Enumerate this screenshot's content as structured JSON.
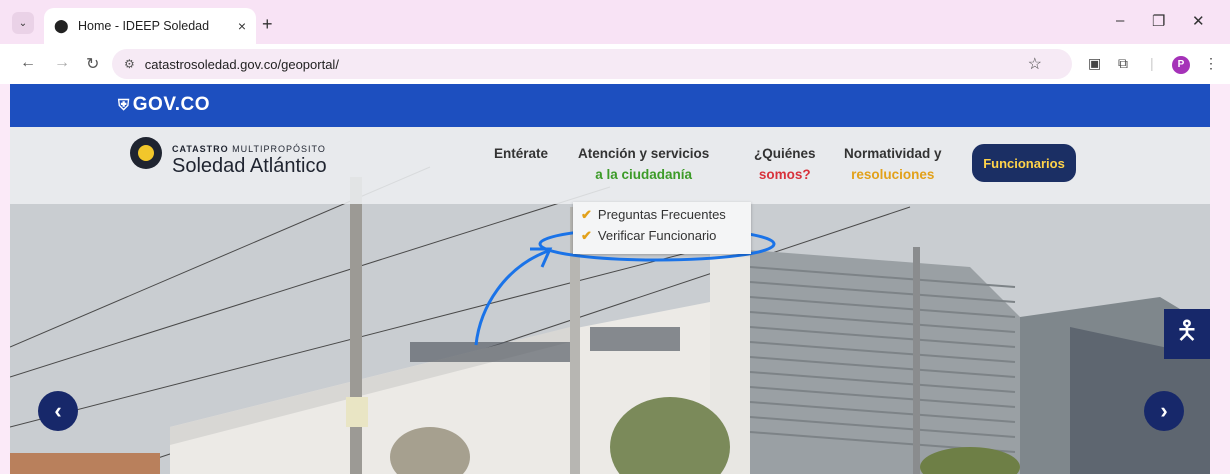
{
  "browser": {
    "tab_title": "Home - IDEEP Soledad",
    "tab_close": "×",
    "new_tab": "+",
    "url": "catastrosoledad.gov.co/geoportal/",
    "profile_initial": "P"
  },
  "gov_bar": {
    "logo_text": "GOV.CO"
  },
  "brand": {
    "small_bold": "CATASTRO",
    "small_rest": " MULTIPROPÓSITO",
    "name": "Soledad Atlántico"
  },
  "nav": {
    "enterate": "Entérate",
    "atencion_1": "Atención y servicios",
    "atencion_2": "a la ciudadanía",
    "quienes_1": "¿Quiénes",
    "quienes_2": "somos?",
    "normatividad_1": "Normatividad y",
    "normatividad_2": "resoluciones",
    "funcionarios": "Funcionarios"
  },
  "dropdown": {
    "items": [
      "Preguntas Frecuentes",
      "Verificar Funcionario"
    ]
  },
  "colors": {
    "gov_blue": "#1d4fbf",
    "navy": "#17286a",
    "gold": "#e2a11a",
    "green": "#3c9b28",
    "red": "#d8323b",
    "annotation_blue": "#1a73e8"
  }
}
